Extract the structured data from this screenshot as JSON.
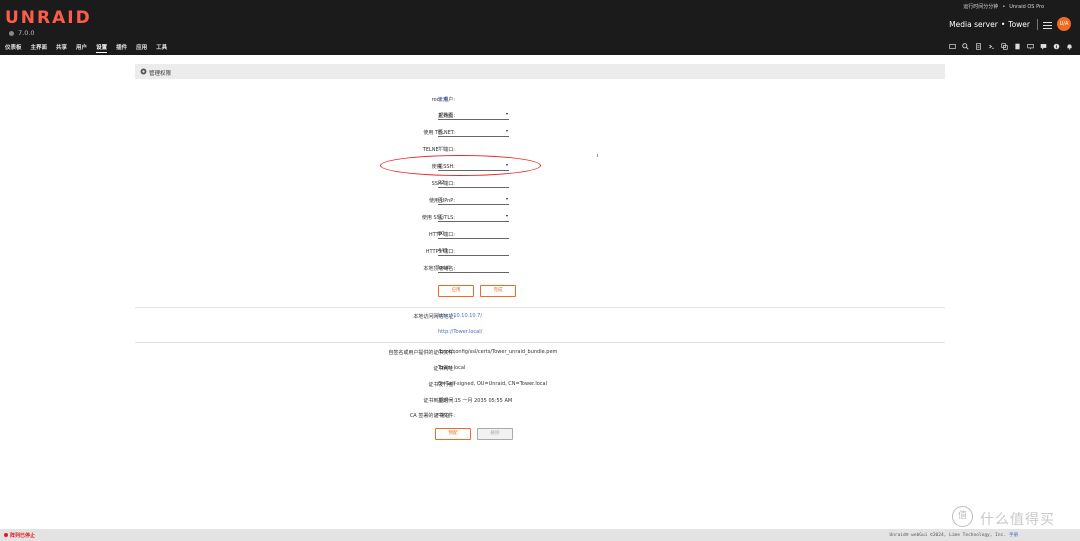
{
  "header": {
    "logo": "UNRAID",
    "version": "7.0.0",
    "uptime": "运行时间分分钟",
    "edition": "Unraid OS Pro",
    "server_name": "Media server",
    "server_bullet": "•",
    "hostname": "Tower",
    "avatar_text": "U/A",
    "brand_color": "#ff5b4a",
    "accent_color": "#ef6b22"
  },
  "nav": {
    "items": [
      "仪表板",
      "主界面",
      "共享",
      "用户",
      "设置",
      "插件",
      "应用",
      "工具"
    ],
    "active_index": 4
  },
  "toolbar": {
    "icons": [
      "terminal-window-icon",
      "search-icon",
      "log-icon",
      "console-icon",
      "copy-icon",
      "docs-icon",
      "display-icon",
      "feedback-icon",
      "info-icon",
      "bell-icon"
    ]
  },
  "panel": {
    "title": "管理权限",
    "icon": "gear-icon"
  },
  "form": {
    "root_user": {
      "label": "root 用户:",
      "value": "管理"
    },
    "start_page": {
      "label": "起始页:",
      "value": "主界面"
    },
    "use_telnet": {
      "label": "使用 TELNET:",
      "value": "否"
    },
    "telnet_port": {
      "label": "TELNET 端口:",
      "value": "23"
    },
    "use_ssh": {
      "label": "使用 SSH:",
      "value": "是"
    },
    "ssh_port": {
      "label": "SSH 端口:",
      "value": "22"
    },
    "use_upnp": {
      "label": "使用 UPnP:",
      "value": "否"
    },
    "use_ssl": {
      "label": "使用 SSL/TLS:",
      "value": "否"
    },
    "http_port": {
      "label": "HTTP 端口:",
      "value": "80"
    },
    "https_port": {
      "label": "HTTPS 端口:",
      "value": "443"
    },
    "local_tld": {
      "label": "本地顶级域名:",
      "value": "local"
    },
    "apply_label": "应用",
    "done_label": "完成"
  },
  "access": {
    "label": "本地访问网络地址:",
    "url1": "http://10.10.10.7/",
    "url2": "http://Tower.local/"
  },
  "cert": {
    "file": {
      "label": "自签名或用户提供的证书文件:",
      "value": "/boot/config/ssl/certs/Tower_unraid_bundle.pem"
    },
    "url": {
      "label": "证书网址:",
      "value": "Tower.local"
    },
    "issuer": {
      "label": "证书发行者:",
      "value": "O=Self-signed, OU=Unraid, CN=Tower.local"
    },
    "expiry": {
      "label": "证书到期时间:",
      "value": "星期一 15 一月 2035 05:55 AM"
    },
    "ca_file": {
      "label": "CA 签署的证书文件:",
      "value": "不存在"
    },
    "provision_label": "预配",
    "delete_label": "删除"
  },
  "footer": {
    "status": "阵列已停止",
    "copyright": "Unraid® webGui ©2024, Lime Technology, Inc.",
    "manual": "手册",
    "status_color": "#e31b1b"
  },
  "watermark": {
    "symbol": "值",
    "text": "什么值得买"
  }
}
